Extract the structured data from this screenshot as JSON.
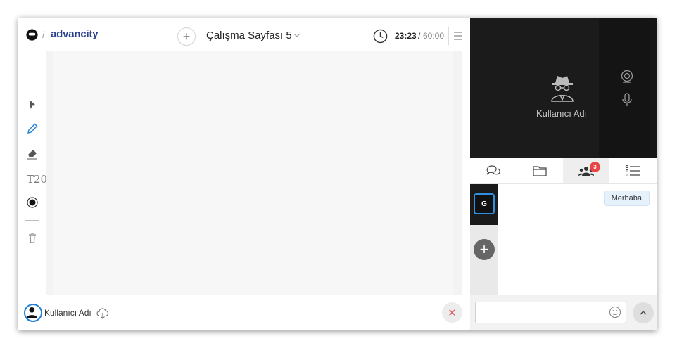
{
  "header": {
    "brand": "advancity",
    "separator": "/",
    "page_title": "Çalışma Sayfası 5",
    "add_page_symbol": "+",
    "timer": {
      "current": "23:23",
      "separator": "/",
      "total": "60:00"
    }
  },
  "toolbar": {
    "tools": [
      {
        "name": "select-tool",
        "icon": "arrow-cursor-icon",
        "label": ""
      },
      {
        "name": "pen-tool",
        "icon": "pencil-icon",
        "label": ""
      },
      {
        "name": "eraser-tool",
        "icon": "eraser-icon",
        "label": ""
      },
      {
        "name": "text-tool",
        "icon": "text-size-icon",
        "label": "T20"
      },
      {
        "name": "color-tool",
        "icon": "color-dot-icon",
        "label": ""
      },
      {
        "name": "delete-tool",
        "icon": "trash-icon",
        "label": ""
      }
    ],
    "active_tool": "pen-tool",
    "accent_color": "#1f7fd6"
  },
  "footer": {
    "user_name": "Kullanıcı Adı",
    "close_symbol": "✕"
  },
  "video": {
    "participant_name": "Kullanıcı Adı"
  },
  "tabs": [
    {
      "name": "tab-chat",
      "icon": "chat-bubbles-icon"
    },
    {
      "name": "tab-files",
      "icon": "folder-icon"
    },
    {
      "name": "tab-participants",
      "icon": "people-icon",
      "badge": "3",
      "active": true
    },
    {
      "name": "tab-list",
      "icon": "list-icon"
    }
  ],
  "channels": {
    "active_label": "G",
    "add_symbol": "+"
  },
  "chat": {
    "messages": [
      {
        "text": "Merhaba"
      }
    ],
    "input_placeholder": ""
  },
  "colors": {
    "brand": "#2b3f8c",
    "badge": "#e94545",
    "close": "#e05a5a"
  }
}
